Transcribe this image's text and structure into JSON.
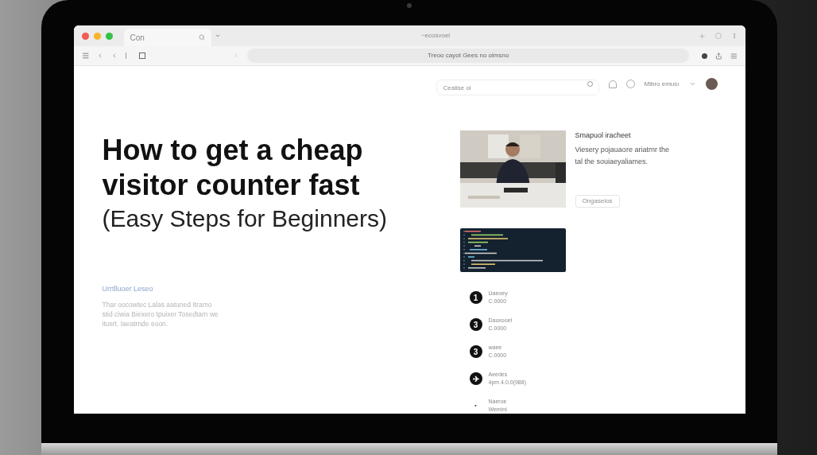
{
  "browser": {
    "tab_title": "Con",
    "window_title": "~ecosvoel",
    "address": "Treoo cayot Gees no oimsno"
  },
  "header": {
    "search_placeholder": "Cealise oi",
    "account_label": "Mibro emusı"
  },
  "hero": {
    "title_lines": [
      "How to get a cheap",
      "visitor counter fast"
    ],
    "subtitle": "(Easy Steps for Beginners)"
  },
  "intro": {
    "label": "Urrtlluoer Leseo",
    "text": "Thar oocowtec Lalas aatuned Itramo stid ciwia Biexero tpuixer Tosedtarn we itusrt. Iaeatrnde eoon."
  },
  "feature": {
    "title": "Smapuol iracheet",
    "text": "Viesery pojauaore ariatrnr the tal the souiaeyaliames.",
    "button": "Ongaselos"
  },
  "steps": [
    {
      "badge": "1",
      "title": "Uaeoey",
      "detail": "C.0000"
    },
    {
      "badge": "3",
      "title": "Dauxooel",
      "detail": "C.0000"
    },
    {
      "badge": "3",
      "title": "waee",
      "detail": "C.0000"
    },
    {
      "badge": "✈",
      "title": "Aeedes",
      "detail": "4pm 4.0.0(988)"
    },
    {
      "badge": "•",
      "title": "Naeroe",
      "detail": "Wemini"
    }
  ]
}
